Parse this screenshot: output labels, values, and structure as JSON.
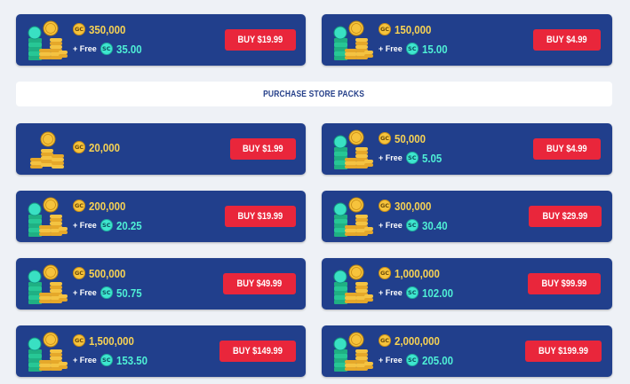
{
  "banner": {
    "label": "PURCHASE STORE PACKS"
  },
  "icons": {
    "gc_badge": "GC",
    "sc_badge": "SC"
  },
  "colors": {
    "card_bg": "#213f8c",
    "gold_text": "#f7d254",
    "sweeps_text": "#4ff0d6",
    "buy_button": "#e9263b",
    "page_bg": "#eef1f6"
  },
  "free_label": "+ Free",
  "packs": [
    {
      "gc": "350,000",
      "sc": "35.00",
      "buy": "BUY $19.99"
    },
    {
      "gc": "150,000",
      "sc": "15.00",
      "buy": "BUY $4.99"
    },
    {
      "gc": "20,000",
      "sc": "",
      "buy": "BUY $1.99"
    },
    {
      "gc": "50,000",
      "sc": "5.05",
      "buy": "BUY $4.99"
    },
    {
      "gc": "200,000",
      "sc": "20.25",
      "buy": "BUY $19.99"
    },
    {
      "gc": "300,000",
      "sc": "30.40",
      "buy": "BUY $29.99"
    },
    {
      "gc": "500,000",
      "sc": "50.75",
      "buy": "BUY $49.99"
    },
    {
      "gc": "1,000,000",
      "sc": "102.00",
      "buy": "BUY $99.99"
    },
    {
      "gc": "1,500,000",
      "sc": "153.50",
      "buy": "BUY $149.99"
    },
    {
      "gc": "2,000,000",
      "sc": "205.00",
      "buy": "BUY $199.99"
    }
  ]
}
